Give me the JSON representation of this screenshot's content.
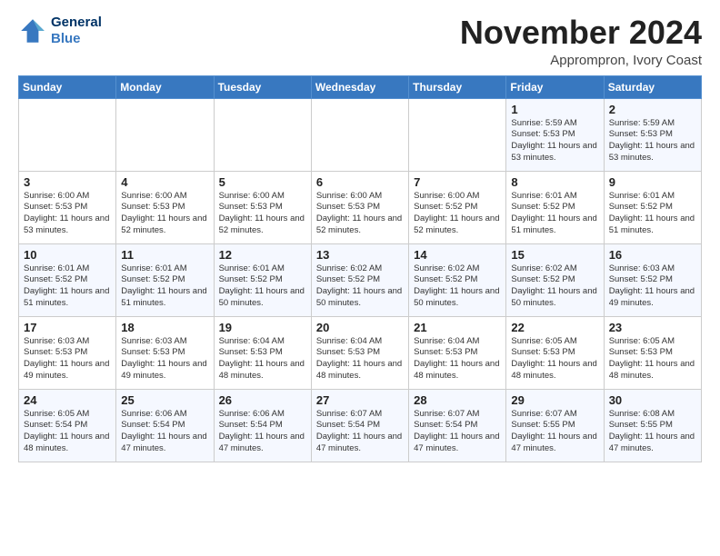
{
  "header": {
    "logo_line1": "General",
    "logo_line2": "Blue",
    "month": "November 2024",
    "location": "Apprompron, Ivory Coast"
  },
  "weekdays": [
    "Sunday",
    "Monday",
    "Tuesday",
    "Wednesday",
    "Thursday",
    "Friday",
    "Saturday"
  ],
  "weeks": [
    [
      {
        "day": "",
        "sunrise": "",
        "sunset": "",
        "daylight": ""
      },
      {
        "day": "",
        "sunrise": "",
        "sunset": "",
        "daylight": ""
      },
      {
        "day": "",
        "sunrise": "",
        "sunset": "",
        "daylight": ""
      },
      {
        "day": "",
        "sunrise": "",
        "sunset": "",
        "daylight": ""
      },
      {
        "day": "",
        "sunrise": "",
        "sunset": "",
        "daylight": ""
      },
      {
        "day": "1",
        "sunrise": "Sunrise: 5:59 AM",
        "sunset": "Sunset: 5:53 PM",
        "daylight": "Daylight: 11 hours and 53 minutes."
      },
      {
        "day": "2",
        "sunrise": "Sunrise: 5:59 AM",
        "sunset": "Sunset: 5:53 PM",
        "daylight": "Daylight: 11 hours and 53 minutes."
      }
    ],
    [
      {
        "day": "3",
        "sunrise": "Sunrise: 6:00 AM",
        "sunset": "Sunset: 5:53 PM",
        "daylight": "Daylight: 11 hours and 53 minutes."
      },
      {
        "day": "4",
        "sunrise": "Sunrise: 6:00 AM",
        "sunset": "Sunset: 5:53 PM",
        "daylight": "Daylight: 11 hours and 52 minutes."
      },
      {
        "day": "5",
        "sunrise": "Sunrise: 6:00 AM",
        "sunset": "Sunset: 5:53 PM",
        "daylight": "Daylight: 11 hours and 52 minutes."
      },
      {
        "day": "6",
        "sunrise": "Sunrise: 6:00 AM",
        "sunset": "Sunset: 5:53 PM",
        "daylight": "Daylight: 11 hours and 52 minutes."
      },
      {
        "day": "7",
        "sunrise": "Sunrise: 6:00 AM",
        "sunset": "Sunset: 5:52 PM",
        "daylight": "Daylight: 11 hours and 52 minutes."
      },
      {
        "day": "8",
        "sunrise": "Sunrise: 6:01 AM",
        "sunset": "Sunset: 5:52 PM",
        "daylight": "Daylight: 11 hours and 51 minutes."
      },
      {
        "day": "9",
        "sunrise": "Sunrise: 6:01 AM",
        "sunset": "Sunset: 5:52 PM",
        "daylight": "Daylight: 11 hours and 51 minutes."
      }
    ],
    [
      {
        "day": "10",
        "sunrise": "Sunrise: 6:01 AM",
        "sunset": "Sunset: 5:52 PM",
        "daylight": "Daylight: 11 hours and 51 minutes."
      },
      {
        "day": "11",
        "sunrise": "Sunrise: 6:01 AM",
        "sunset": "Sunset: 5:52 PM",
        "daylight": "Daylight: 11 hours and 51 minutes."
      },
      {
        "day": "12",
        "sunrise": "Sunrise: 6:01 AM",
        "sunset": "Sunset: 5:52 PM",
        "daylight": "Daylight: 11 hours and 50 minutes."
      },
      {
        "day": "13",
        "sunrise": "Sunrise: 6:02 AM",
        "sunset": "Sunset: 5:52 PM",
        "daylight": "Daylight: 11 hours and 50 minutes."
      },
      {
        "day": "14",
        "sunrise": "Sunrise: 6:02 AM",
        "sunset": "Sunset: 5:52 PM",
        "daylight": "Daylight: 11 hours and 50 minutes."
      },
      {
        "day": "15",
        "sunrise": "Sunrise: 6:02 AM",
        "sunset": "Sunset: 5:52 PM",
        "daylight": "Daylight: 11 hours and 50 minutes."
      },
      {
        "day": "16",
        "sunrise": "Sunrise: 6:03 AM",
        "sunset": "Sunset: 5:52 PM",
        "daylight": "Daylight: 11 hours and 49 minutes."
      }
    ],
    [
      {
        "day": "17",
        "sunrise": "Sunrise: 6:03 AM",
        "sunset": "Sunset: 5:53 PM",
        "daylight": "Daylight: 11 hours and 49 minutes."
      },
      {
        "day": "18",
        "sunrise": "Sunrise: 6:03 AM",
        "sunset": "Sunset: 5:53 PM",
        "daylight": "Daylight: 11 hours and 49 minutes."
      },
      {
        "day": "19",
        "sunrise": "Sunrise: 6:04 AM",
        "sunset": "Sunset: 5:53 PM",
        "daylight": "Daylight: 11 hours and 48 minutes."
      },
      {
        "day": "20",
        "sunrise": "Sunrise: 6:04 AM",
        "sunset": "Sunset: 5:53 PM",
        "daylight": "Daylight: 11 hours and 48 minutes."
      },
      {
        "day": "21",
        "sunrise": "Sunrise: 6:04 AM",
        "sunset": "Sunset: 5:53 PM",
        "daylight": "Daylight: 11 hours and 48 minutes."
      },
      {
        "day": "22",
        "sunrise": "Sunrise: 6:05 AM",
        "sunset": "Sunset: 5:53 PM",
        "daylight": "Daylight: 11 hours and 48 minutes."
      },
      {
        "day": "23",
        "sunrise": "Sunrise: 6:05 AM",
        "sunset": "Sunset: 5:53 PM",
        "daylight": "Daylight: 11 hours and 48 minutes."
      }
    ],
    [
      {
        "day": "24",
        "sunrise": "Sunrise: 6:05 AM",
        "sunset": "Sunset: 5:54 PM",
        "daylight": "Daylight: 11 hours and 48 minutes."
      },
      {
        "day": "25",
        "sunrise": "Sunrise: 6:06 AM",
        "sunset": "Sunset: 5:54 PM",
        "daylight": "Daylight: 11 hours and 47 minutes."
      },
      {
        "day": "26",
        "sunrise": "Sunrise: 6:06 AM",
        "sunset": "Sunset: 5:54 PM",
        "daylight": "Daylight: 11 hours and 47 minutes."
      },
      {
        "day": "27",
        "sunrise": "Sunrise: 6:07 AM",
        "sunset": "Sunset: 5:54 PM",
        "daylight": "Daylight: 11 hours and 47 minutes."
      },
      {
        "day": "28",
        "sunrise": "Sunrise: 6:07 AM",
        "sunset": "Sunset: 5:54 PM",
        "daylight": "Daylight: 11 hours and 47 minutes."
      },
      {
        "day": "29",
        "sunrise": "Sunrise: 6:07 AM",
        "sunset": "Sunset: 5:55 PM",
        "daylight": "Daylight: 11 hours and 47 minutes."
      },
      {
        "day": "30",
        "sunrise": "Sunrise: 6:08 AM",
        "sunset": "Sunset: 5:55 PM",
        "daylight": "Daylight: 11 hours and 47 minutes."
      }
    ]
  ]
}
